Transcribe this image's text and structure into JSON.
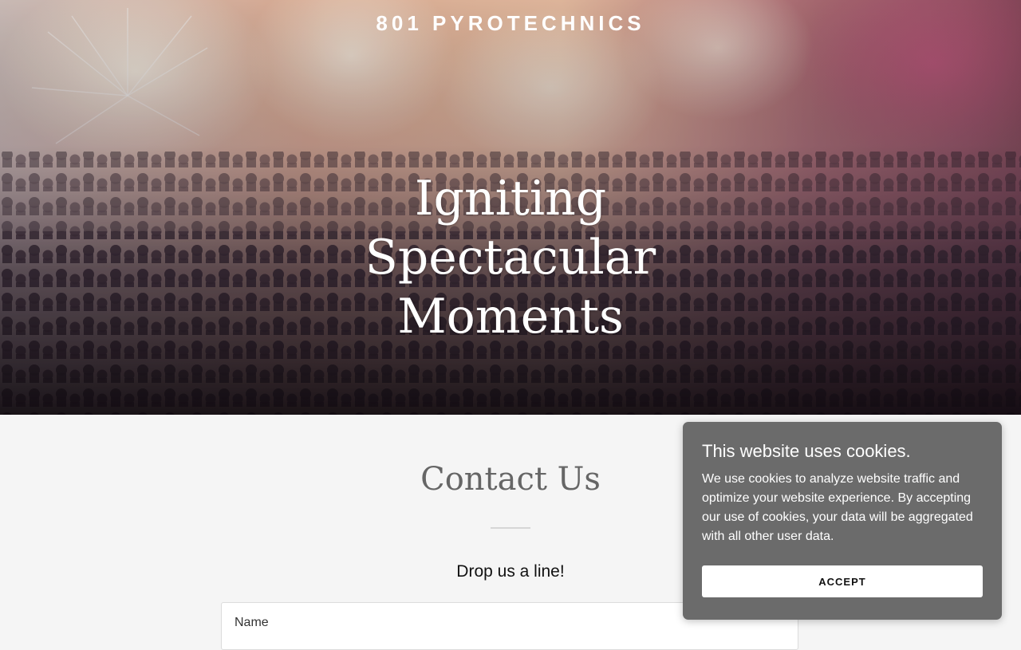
{
  "header": {
    "site_title": "801 PYROTECHNICS"
  },
  "hero": {
    "heading_line1": "Igniting Spectacular",
    "heading_line2": "Moments"
  },
  "contact": {
    "title": "Contact Us",
    "subtitle": "Drop us a line!",
    "name_label": "Name"
  },
  "cookie_banner": {
    "title": "This website uses cookies.",
    "text": "We use cookies to analyze website traffic and optimize your website experience. By accepting our use of cookies, your data will be aggregated with all other user data.",
    "accept_label": "ACCEPT"
  },
  "colors": {
    "hero_text": "#ffffff",
    "cookie_bg": "#6b6b6b",
    "page_bg": "#f5f5f5"
  }
}
